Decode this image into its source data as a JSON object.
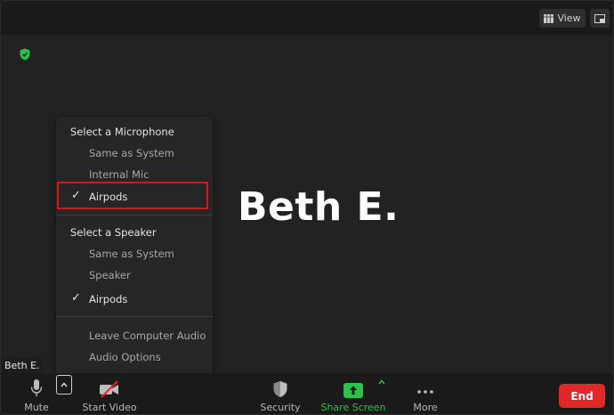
{
  "top_bar": {
    "view_label": "View"
  },
  "stage": {
    "participant_name": "Beth E.",
    "name_tag": "Beth E."
  },
  "audio_menu": {
    "microphone_header": "Select a Microphone",
    "microphones": [
      {
        "label": "Same as System",
        "checked": false
      },
      {
        "label": "Internal Mic",
        "checked": false
      },
      {
        "label": "Airpods",
        "checked": true
      }
    ],
    "speaker_header": "Select a Speaker",
    "speakers": [
      {
        "label": "Same as System",
        "checked": false
      },
      {
        "label": "Speaker",
        "checked": false
      },
      {
        "label": "Airpods",
        "checked": true
      }
    ],
    "leave_audio": "Leave Computer Audio",
    "audio_options": "Audio Options",
    "check_glyph": "✓"
  },
  "toolbar": {
    "mute_label": "Mute",
    "start_video_label": "Start Video",
    "security_label": "Security",
    "share_screen_label": "Share Screen",
    "more_label": "More",
    "end_label": "End"
  },
  "colors": {
    "accent_green": "#30c14b",
    "end_red": "#e02828",
    "highlight_red": "#d3171b",
    "shield_green": "#2fbf4f"
  }
}
